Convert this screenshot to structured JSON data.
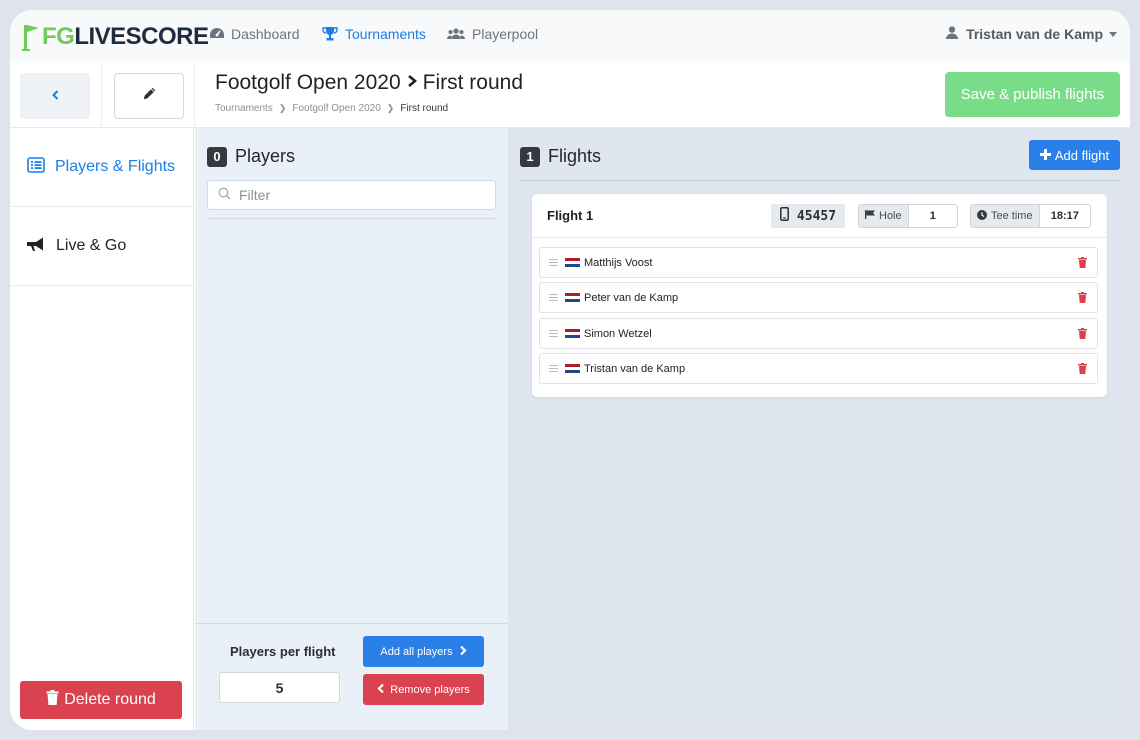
{
  "brand": {
    "logo_fg": "FG",
    "logo_text": "LIVESCORE",
    "colors": {
      "green": "#74c95c",
      "navy": "#1f2b3e"
    }
  },
  "nav": {
    "items": [
      {
        "label": "Dashboard",
        "icon": "dashboard-icon",
        "active": false
      },
      {
        "label": "Tournaments",
        "icon": "trophy-icon",
        "active": true
      },
      {
        "label": "Playerpool",
        "icon": "users-icon",
        "active": false
      }
    ],
    "user_name": "Tristan van de Kamp"
  },
  "header": {
    "title_part1": "Footgolf Open 2020",
    "title_part2": "First round",
    "breadcrumb": [
      "Tournaments",
      "Footgolf Open 2020",
      "First round"
    ],
    "publish_label": "Save & publish flights"
  },
  "sidebar": {
    "items": [
      {
        "label": "Players & Flights",
        "icon": "list-icon",
        "active": true
      },
      {
        "label": "Live & Go",
        "icon": "megaphone-icon",
        "active": false
      }
    ],
    "delete_label": "Delete round"
  },
  "players": {
    "count": "0",
    "heading": "Players",
    "filter_placeholder": "Filter",
    "per_flight_label": "Players per flight",
    "per_flight_value": "5",
    "add_all_label": "Add all players",
    "remove_label": "Remove players"
  },
  "flights": {
    "count": "1",
    "heading": "Flights",
    "add_label": "Add flight",
    "list": [
      {
        "name": "Flight 1",
        "code": "45457",
        "hole_label": "Hole",
        "hole": "1",
        "tee_label": "Tee time",
        "tee_time": "18:17",
        "players": [
          {
            "name": "Matthijs Voost",
            "flag": "nl-flag-icon"
          },
          {
            "name": "Peter van de Kamp",
            "flag": "nl-flag-icon"
          },
          {
            "name": "Simon Wetzel",
            "flag": "nl-flag-icon"
          },
          {
            "name": "Tristan van de Kamp",
            "flag": "nl-flag-icon"
          }
        ]
      }
    ]
  }
}
